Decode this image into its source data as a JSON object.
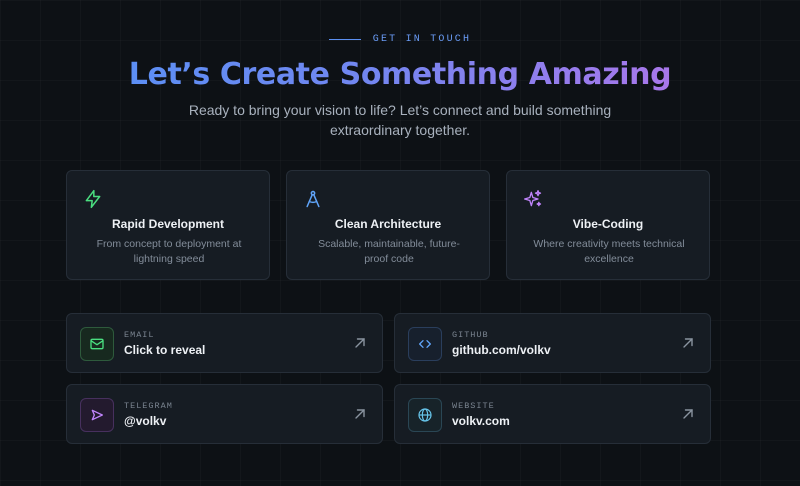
{
  "header": {
    "eyebrow": "GET IN TOUCH",
    "title": "Let’s Create Something Amazing",
    "subtitle": "Ready to bring your vision to life? Let’s connect and build something extraordinary together."
  },
  "features": [
    {
      "icon": "lightning-icon",
      "title": "Rapid Development",
      "description": "From concept to deployment at lightning speed",
      "accent": "#4ade80"
    },
    {
      "icon": "compass-icon",
      "title": "Clean Architecture",
      "description": "Scalable, maintainable, future-proof code",
      "accent": "#60a5fa"
    },
    {
      "icon": "sparkles-icon",
      "title": "Vibe-Coding",
      "description": "Where creativity meets technical excellence",
      "accent": "#c084fc"
    }
  ],
  "contacts": [
    {
      "icon": "mail-icon",
      "label": "EMAIL",
      "value": "Click to reveal",
      "accent": "#4ade80"
    },
    {
      "icon": "code-icon",
      "label": "GITHUB",
      "value": "github.com/volkv",
      "accent": "#60a5fa"
    },
    {
      "icon": "send-icon",
      "label": "TELEGRAM",
      "value": "@volkv",
      "accent": "#c084fc"
    },
    {
      "icon": "globe-icon",
      "label": "WEBSITE",
      "value": "volkv.com",
      "accent": "#67c5ea"
    }
  ],
  "colors": {
    "background": "#0d1115",
    "card": "#161c23",
    "border": "#262e38",
    "gradient_start": "#5c8ff4",
    "gradient_end": "#a877ea"
  }
}
